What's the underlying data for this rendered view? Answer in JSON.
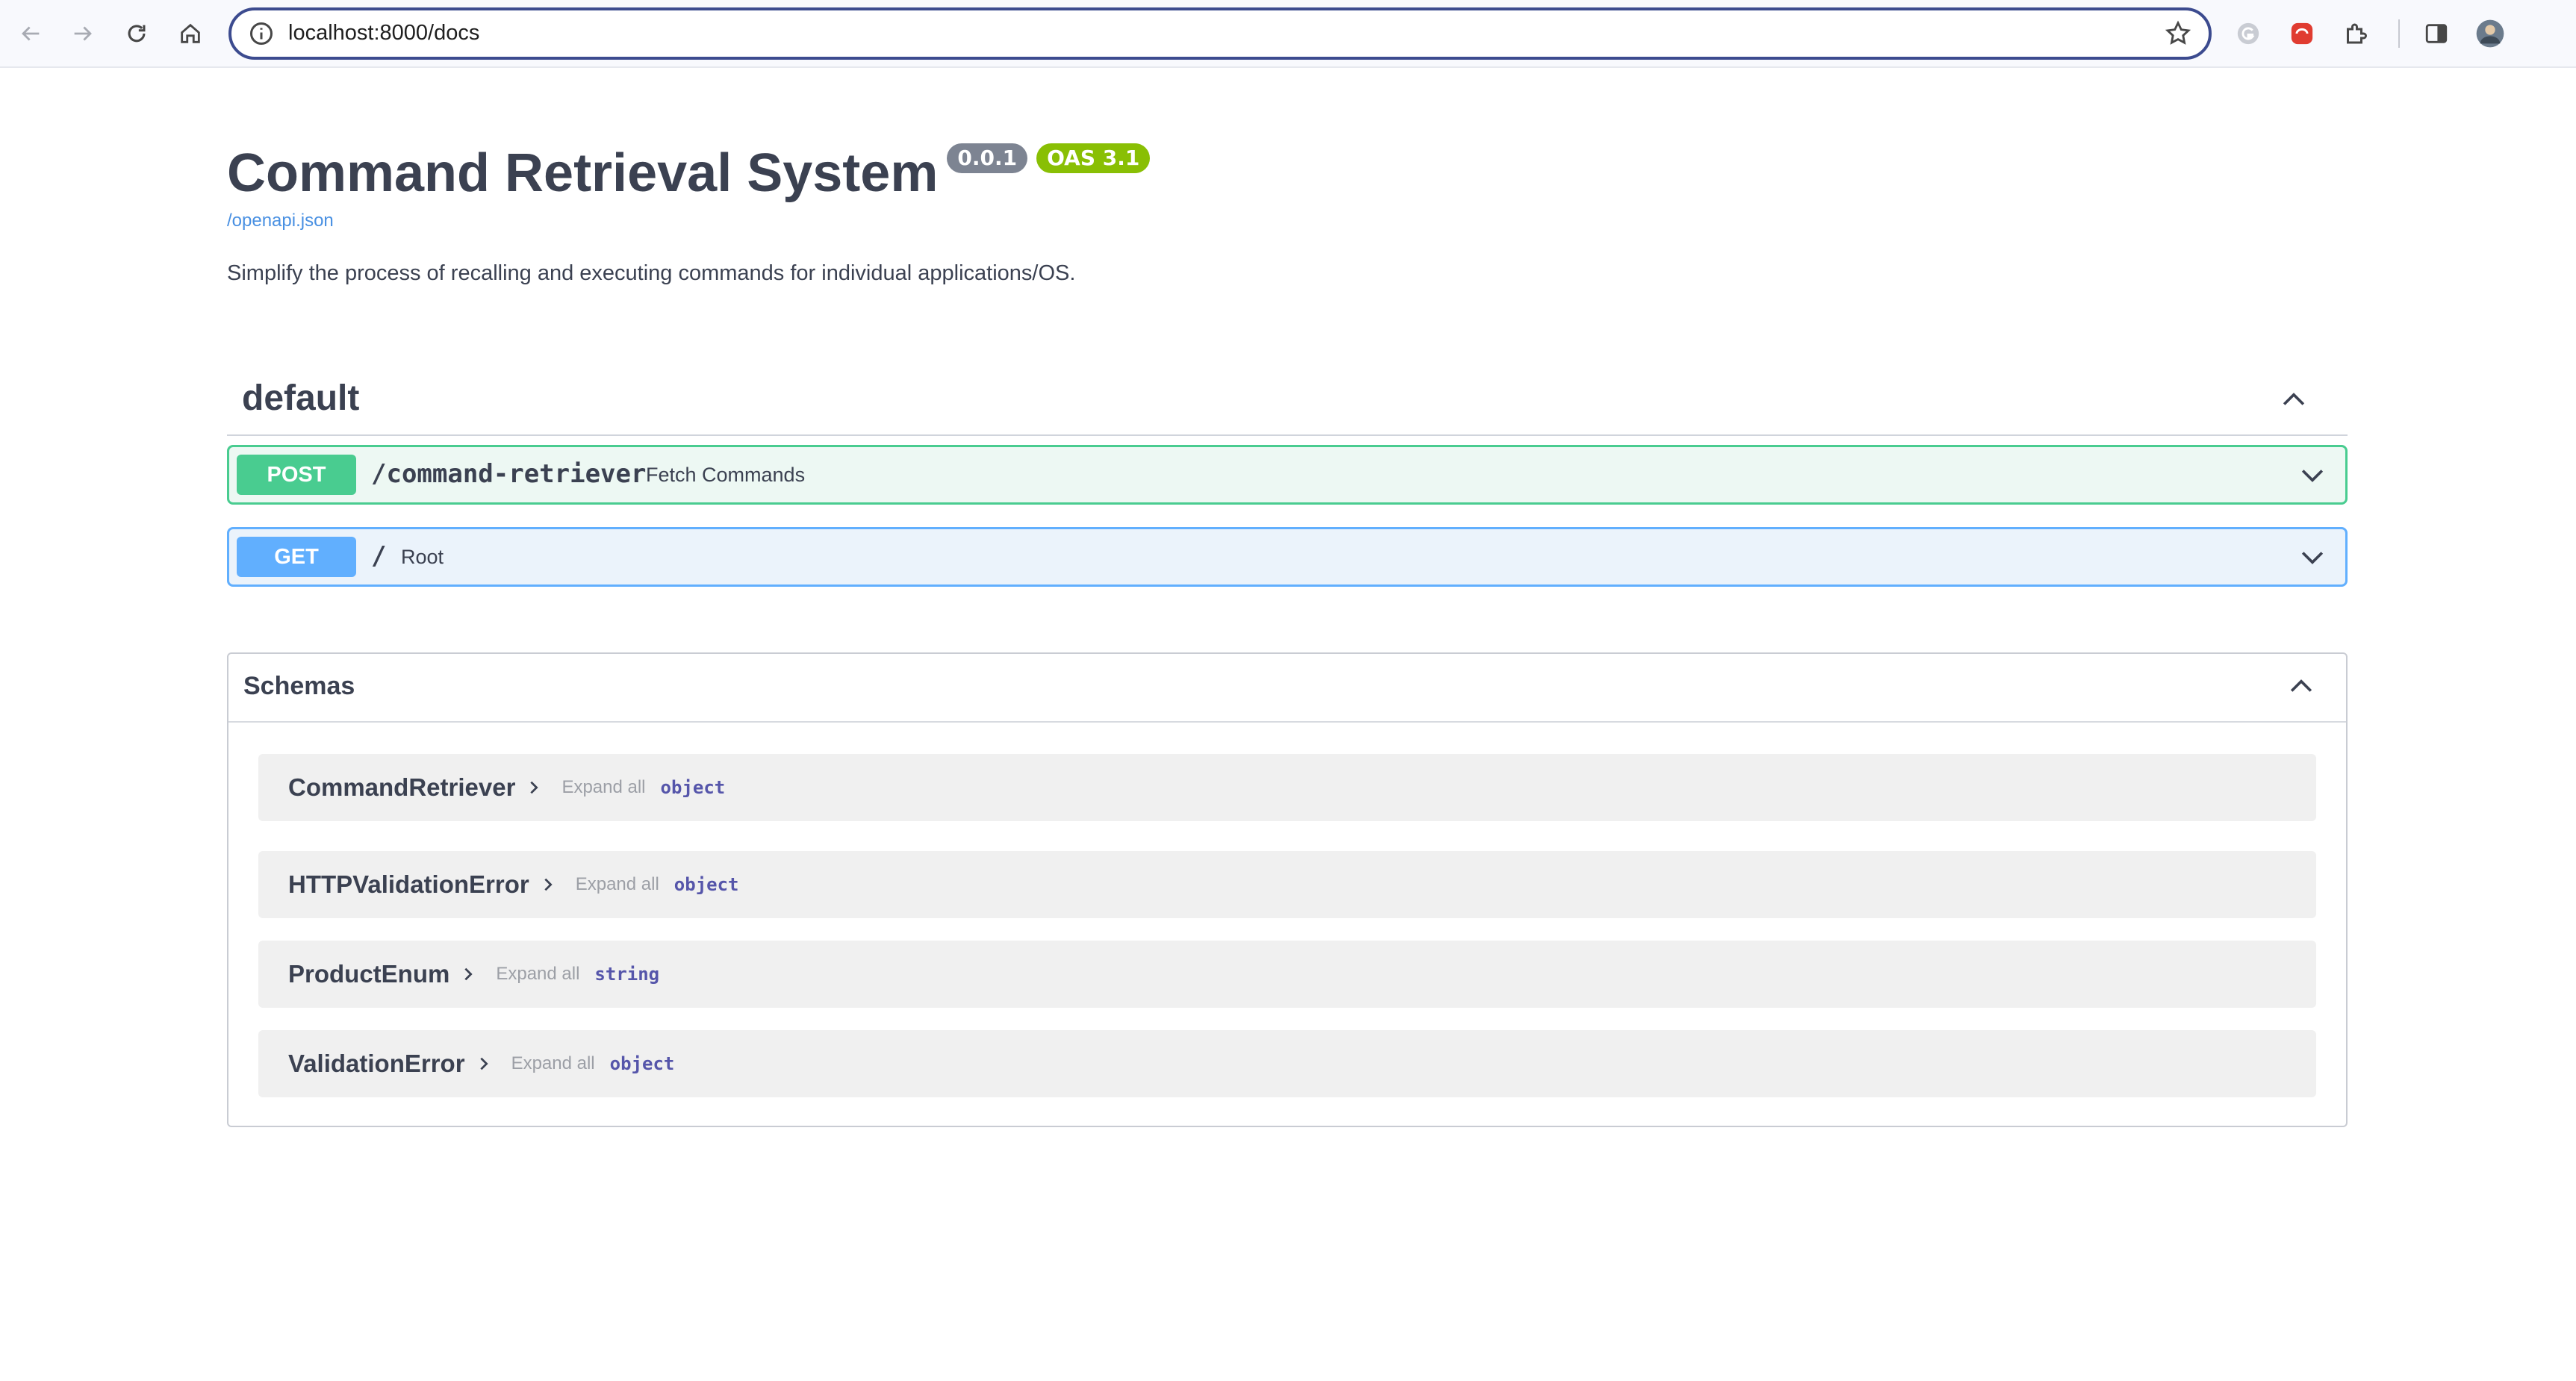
{
  "browser": {
    "url": "localhost:8000/docs",
    "icons": [
      "back-arrow-icon",
      "forward-arrow-icon",
      "reload-icon",
      "home-icon",
      "site-info-icon",
      "bookmark-star-icon",
      "extension-g-icon",
      "extension-red-icon",
      "puzzle-extensions-icon",
      "side-panel-icon",
      "profile-avatar-icon"
    ]
  },
  "api": {
    "title": "Command Retrieval System",
    "version": "0.0.1",
    "oas": "OAS 3.1",
    "spec_link": "/openapi.json",
    "description": "Simplify the process of recalling and executing commands for individual applications/OS."
  },
  "tag": {
    "name": "default",
    "operations": [
      {
        "method": "POST",
        "path": "/command-retriever",
        "summary": "Fetch Commands"
      },
      {
        "method": "GET",
        "path": "/",
        "summary": "Root"
      }
    ]
  },
  "schemas": {
    "title": "Schemas",
    "items": [
      {
        "name": "CommandRetriever",
        "expand": "Expand all",
        "type": "object"
      },
      {
        "name": "HTTPValidationError",
        "expand": "Expand all",
        "type": "object"
      },
      {
        "name": "ProductEnum",
        "expand": "Expand all",
        "type": "string"
      },
      {
        "name": "ValidationError",
        "expand": "Expand all",
        "type": "object"
      }
    ]
  },
  "colors": {
    "post": "#49cc90",
    "get": "#61affe",
    "oas_badge": "#89bf04",
    "version_badge": "#7d8492",
    "link": "#4990e2"
  }
}
